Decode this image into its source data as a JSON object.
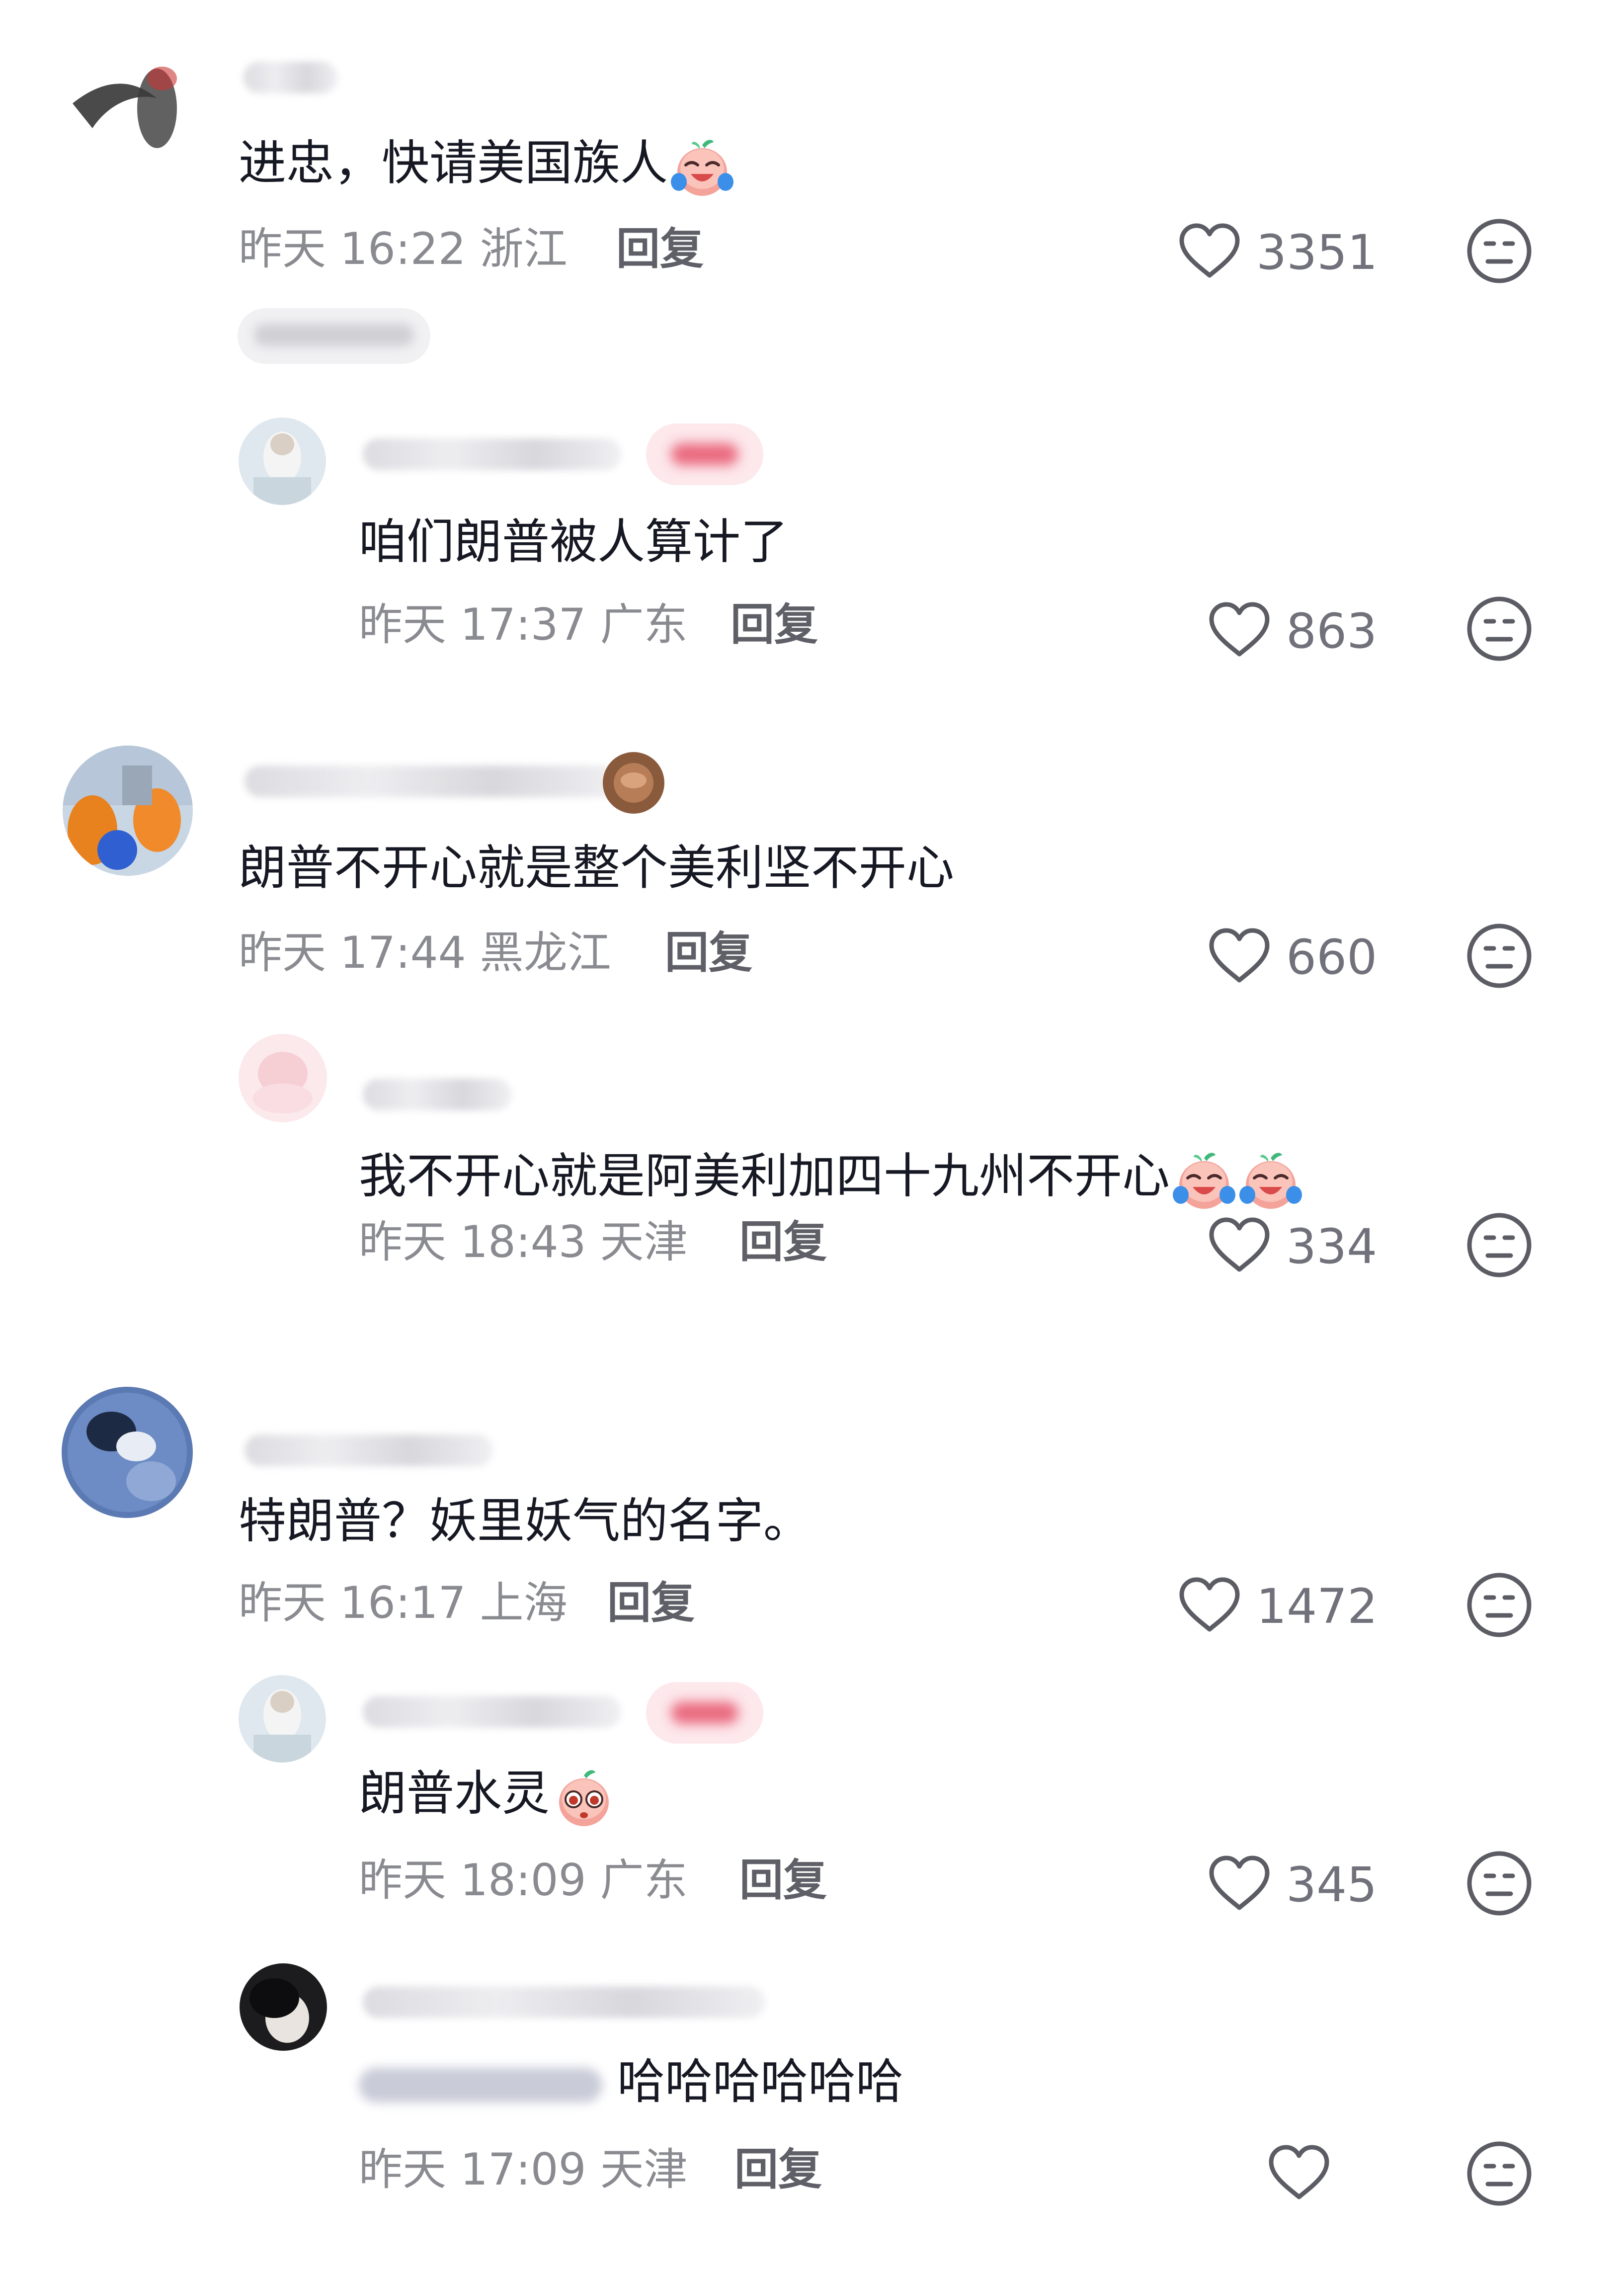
{
  "comments": [
    {
      "text": "进忠，快请美国族人",
      "emoji": "crying-laughing-emoji",
      "time": "昨天 16:22",
      "location": "浙江",
      "reply_label": "回复",
      "likes": "3351",
      "replies": [
        {
          "author_tag": "作者",
          "text": "咱们朗普被人算计了",
          "time": "昨天 17:37",
          "location": "广东",
          "reply_label": "回复",
          "likes": "863"
        }
      ]
    },
    {
      "text": "朗普不开心就是整个美利坚不开心",
      "time": "昨天 17:44",
      "location": "黑龙江",
      "reply_label": "回复",
      "likes": "660",
      "replies": [
        {
          "text": "我不开心就是阿美利加四十九州不开心",
          "emoji": "crying-laughing-emoji",
          "time": "昨天 18:43",
          "location": "天津",
          "reply_label": "回复",
          "likes": "334"
        }
      ]
    },
    {
      "text": "特朗普？妖里妖气的名字。",
      "time": "昨天 16:17",
      "location": "上海",
      "reply_label": "回复",
      "likes": "1472",
      "replies": [
        {
          "author_tag": "作者",
          "text": "朗普水灵",
          "emoji": "pleading-face-emoji",
          "time": "昨天 18:09",
          "location": "广东",
          "reply_label": "回复",
          "likes": "345"
        },
        {
          "text": "哈哈哈哈哈哈",
          "time": "昨天 17:09",
          "location": "天津",
          "reply_label": "回复"
        }
      ]
    }
  ],
  "icons": {
    "like": "heart-outline-icon",
    "dislike": "neutral-face-icon"
  },
  "colors": {
    "text": "#161823",
    "meta": "#8a8b91",
    "author_tag_bg": "#fde8ec"
  }
}
